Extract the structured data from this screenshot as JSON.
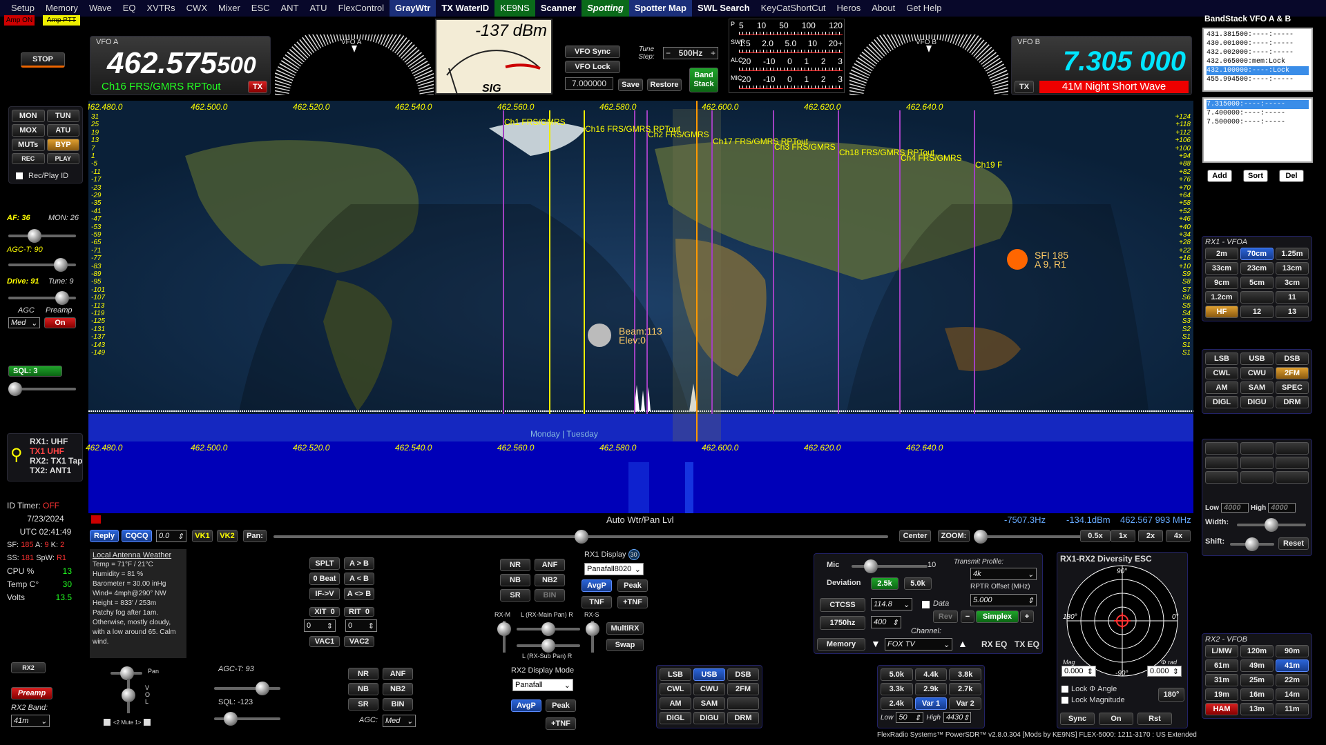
{
  "menu": [
    "Setup",
    "Memory",
    "Wave",
    "EQ",
    "XVTRs",
    "CWX",
    "Mixer",
    "ESC",
    "ANT",
    "ATU",
    "FlexControl",
    "GrayWtr",
    "TX WaterID",
    "KE9NS",
    "Scanner",
    "Spotting",
    "Spotter Map",
    "SWL Search",
    "KeyCatShortCut",
    "Heros",
    "About",
    "Get Help"
  ],
  "amp_on": "Amp ON",
  "amp_ptt": "Amp PTT",
  "stop_btn": "STOP",
  "vfo_a": {
    "label": "VFO A",
    "freq": "462.575",
    "freq_small": "500",
    "name": "Ch16 FRS/GMRS RPTout",
    "tx": "TX"
  },
  "vfo_b": {
    "label": "VFO B",
    "freq": "7.305 000",
    "name": "41M Night Short Wave",
    "tx": "TX"
  },
  "dial_a_label": "VFO A",
  "dial_b_label": "VFO B",
  "smeter": {
    "value": "-137 dBm",
    "label": "SIG"
  },
  "vfo_sync": "VFO Sync",
  "vfo_lock": "VFO Lock",
  "tune_step_label": "Tune Step:",
  "tune_step": "500Hz",
  "tune_freq": "7.000000",
  "save": "Save",
  "restore": "Restore",
  "band_stack": "Band Stack",
  "meters": [
    {
      "label": "P",
      "scale": [
        "5",
        "10",
        "50",
        "100",
        "120"
      ]
    },
    {
      "label": "SWR",
      "scale": [
        "1.5",
        "2.0",
        "5.0",
        "10",
        "20+"
      ]
    },
    {
      "label": "ALC",
      "scale": [
        "-20",
        "-10",
        "0",
        "1",
        "2",
        "3"
      ]
    },
    {
      "label": "MIC",
      "scale": [
        "-20",
        "-10",
        "0",
        "1",
        "2",
        "3"
      ]
    }
  ],
  "bandstack": {
    "title": "BandStack VFO A & B",
    "a": [
      "431.381500:----:-----",
      "430.001000:----:-----",
      "432.002000:----:-----",
      "432.065000:mem:Lock",
      "432.100000:----:Lock",
      "455.994500:----:-----"
    ],
    "b": [
      "7.315000:----:-----",
      "7.400000:----:-----",
      "7.500000:----:-----"
    ],
    "add": "Add",
    "sort": "Sort",
    "del": "Del"
  },
  "left": {
    "mon": "MON",
    "tun": "TUN",
    "mox": "MOX",
    "atu": "ATU",
    "muts": "MUTs",
    "byp": "BYP",
    "rec": "REC",
    "play": "PLAY",
    "rec_play_id": "Rec/Play ID",
    "af": "AF: 36",
    "mon_val": "MON: 26",
    "agct": "AGC-T: 90",
    "drive": "Drive: 91",
    "tune": "Tune: 9",
    "agc": "AGC",
    "preamp": "Preamp",
    "agc_val": "Med",
    "preamp_val": "On",
    "sql": "SQL: 3",
    "rx1": "RX1: UHF",
    "tx1": "TX1 UHF",
    "rx2": "RX2: TX1 Tap",
    "tx2": "TX2: ANT1",
    "id_timer": "ID Timer:",
    "id_timer_val": "OFF",
    "date": "7/23/2024",
    "utc": "UTC 02:41:49",
    "sf": "SF:",
    "sf_val": "185",
    "a": "A:",
    "a_val": "9",
    "k": "K:",
    "k_val": "2",
    "ss": "SS:",
    "ss_val": "181",
    "spw": "SpW:",
    "spw_val": "R1",
    "cpu": "CPU %",
    "cpu_val": "13",
    "temp": "Temp C°",
    "temp_val": "30",
    "volts": "Volts",
    "volts_val": "13.5",
    "rx2_btn": "RX2",
    "preamp_btn": "Preamp",
    "rx2_band": "RX2 Band:",
    "rx2_band_val": "41m"
  },
  "freq_ticks": [
    "462.480.0",
    "462.500.0",
    "462.520.0",
    "462.540.0",
    "462.560.0",
    "462.580.0",
    "462.600.0",
    "462.620.0",
    "462.640.0"
  ],
  "dbm_left": [
    "31",
    "25",
    "19",
    "13",
    "7",
    "1",
    "-5",
    "-11",
    "-17",
    "-23",
    "-29",
    "-35",
    "-41",
    "-47",
    "-53",
    "-59",
    "-65",
    "-71",
    "-77",
    "-83",
    "-89",
    "-95",
    "-101",
    "-107",
    "-113",
    "-119",
    "-125",
    "-131",
    "-137",
    "-143",
    "-149"
  ],
  "s_right": [
    "+124",
    "+118",
    "+112",
    "+106",
    "+100",
    "+94",
    "+88",
    "+82",
    "+76",
    "+70",
    "+64",
    "+58",
    "+52",
    "+46",
    "+40",
    "+34",
    "+28",
    "+22",
    "+16",
    "+10",
    "S9",
    "S8",
    "S7",
    "S6",
    "S5",
    "S4",
    "S3",
    "S2",
    "S1",
    "S1",
    "S1"
  ],
  "spots": [
    {
      "t": "Ch1 FRS/GMRS"
    },
    {
      "t": "Ch16 FRS/GMRS RPTout"
    },
    {
      "t": "Ch2 FRS/GMRS"
    },
    {
      "t": "Ch17 FRS/GMRS RPTout"
    },
    {
      "t": "Ch3 FRS/GMRS"
    },
    {
      "t": "Ch18 FRS/GMRS RPTout"
    },
    {
      "t": "Ch4 FRS/GMRS"
    },
    {
      "t": "Ch19 F"
    }
  ],
  "sun": "SFI 185\nA 9, R1",
  "moon": "Beam:113\nElev:0",
  "daybar": "Monday | Tuesday",
  "status": {
    "title": "Auto Wtr/Pan Lvl",
    "offset": "-7507.3Hz",
    "dbm": "-134.1dBm",
    "freq": "462.567 993 MHz"
  },
  "pan": {
    "reply": "Reply",
    "cqcq": "CQCQ",
    "val": "0.0",
    "vk1": "VK1",
    "vk2": "VK2",
    "pan": "Pan:",
    "center": "Center",
    "zoom": "ZOOM:",
    "z05": "0.5x",
    "z1": "1x",
    "z2": "2x",
    "z4": "4x"
  },
  "weather": [
    "Local Antenna Weather",
    "Temp = 71°F / 21°C",
    "Humidity = 81 %",
    "Barometer = 30.00 inHg",
    "Wind= 4mph@290° NW",
    "Height = 833' / 253m",
    "Patchy fog after 1am. Otherwise, mostly cloudy, with a low around 65. Calm wind."
  ],
  "mid1": {
    "splt": "SPLT",
    "ab": "A > B",
    "beat": "0 Beat",
    "ba": "A < B",
    "ifv": "IF->V",
    "aswap": "A <> B",
    "xit": "XIT",
    "xit_v": "0",
    "rit": "RIT",
    "rit_v": "0",
    "xit_in": "0",
    "rit_in": "0",
    "vac1": "VAC1",
    "vac2": "VAC2"
  },
  "dsp1": {
    "nr": "NR",
    "anf": "ANF",
    "nb": "NB",
    "nb2": "NB2",
    "sr": "SR",
    "bin": "BIN"
  },
  "rx1disp": {
    "label": "RX1 Display",
    "num": "30",
    "mode": "Panafall8020",
    "avgp": "AvgP",
    "peak": "Peak",
    "tnf": "TNF",
    "ptnf": "+TNF"
  },
  "mix": {
    "rxm": "RX-M",
    "main": "L (RX-Main Pan) R",
    "rxs": "RX-S",
    "sub": "L (RX-Sub Pan) R",
    "multirx": "MultiRX",
    "swap": "Swap"
  },
  "rx2ctl": {
    "pan": "Pan",
    "vol": "V\nO\nL",
    "mute": "<2 Mute 1>",
    "agct": "AGC-T: 93",
    "sql": "SQL: -123"
  },
  "dsp2": {
    "nr": "NR",
    "anf": "ANF",
    "nb": "NB",
    "nb2": "NB2",
    "sr": "SR",
    "bin": "BIN",
    "agc": "AGC:",
    "agc_v": "Med"
  },
  "rx2disp": {
    "label": "RX2 Display Mode",
    "mode": "Panafall",
    "avgp": "AvgP",
    "peak": "Peak",
    "ptnf": "+TNF"
  },
  "modes_bottom": [
    "LSB",
    "USB",
    "DSB",
    "CWL",
    "CWU",
    "2FM",
    "AM",
    "SAM",
    "",
    "DIGL",
    "DIGU",
    "DRM"
  ],
  "fm": {
    "mic": "Mic",
    "mic_v": "10",
    "dev": "Deviation",
    "d25": "2.5k",
    "d50": "5.0k",
    "ctcss": "CTCSS",
    "ctcss_v": "114.8",
    "data": "Data",
    "t1750": "1750hz",
    "t400": "400",
    "memory": "Memory",
    "channel": "Channel:",
    "channel_v": "FOX TV",
    "profile": "Transmit Profile:",
    "profile_v": "4k",
    "rptr": "RPTR Offset (MHz)",
    "rptr_v": "5.000",
    "rev": "Rev",
    "minus": "−",
    "simplex": "Simplex",
    "plus": "+",
    "rxeq": "RX EQ",
    "txeq": "TX EQ"
  },
  "filters": [
    "5.0k",
    "4.4k",
    "3.8k",
    "3.3k",
    "2.9k",
    "2.7k",
    "2.4k",
    "Var 1",
    "Var 2"
  ],
  "filter_low": "Low",
  "filter_low_v": "50",
  "filter_high": "High",
  "filter_high_v": "4430",
  "diversity": {
    "title": "RX1-RX2 Diversity ESC",
    "mag": "Mag",
    "mag_v": "0.000",
    "rad": "Φ rad",
    "rad_v": "0.000",
    "lock_a": "Lock Φ Angle",
    "lock_m": "Lock Magnitude",
    "deg": "180°",
    "sync": "Sync",
    "on": "On",
    "rst": "Rst",
    "n90": "90°",
    "s90": "-90°",
    "w180": "180°",
    "e0": "0°"
  },
  "rx1vfoa": {
    "title": "RX1 - VFOA",
    "bands": [
      "2m",
      "70cm",
      "1.25m",
      "33cm",
      "23cm",
      "13cm",
      "9cm",
      "5cm",
      "3cm",
      "1.2cm",
      "",
      "11",
      "HF",
      "12",
      "13"
    ]
  },
  "modes_right": [
    "LSB",
    "USB",
    "DSB",
    "CWL",
    "CWU",
    "2FM",
    "AM",
    "SAM",
    "SPEC",
    "DIGL",
    "DIGU",
    "DRM"
  ],
  "filter_r": {
    "low": "Low",
    "low_v": "4000",
    "high": "High",
    "high_v": "4000",
    "width": "Width:",
    "shift": "Shift:",
    "reset": "Reset"
  },
  "rx2vfob": {
    "title": "RX2 - VFOB",
    "bands": [
      "L/MW",
      "120m",
      "90m",
      "61m",
      "49m",
      "41m",
      "31m",
      "25m",
      "22m",
      "19m",
      "16m",
      "14m",
      "HAM",
      "13m",
      "11m"
    ]
  },
  "footer": "FlexRadio Systems™  PowerSDR™  v2.8.0.304   [Mods by KE9NS]   FLEX-5000: 1211-3170  : US Extended"
}
